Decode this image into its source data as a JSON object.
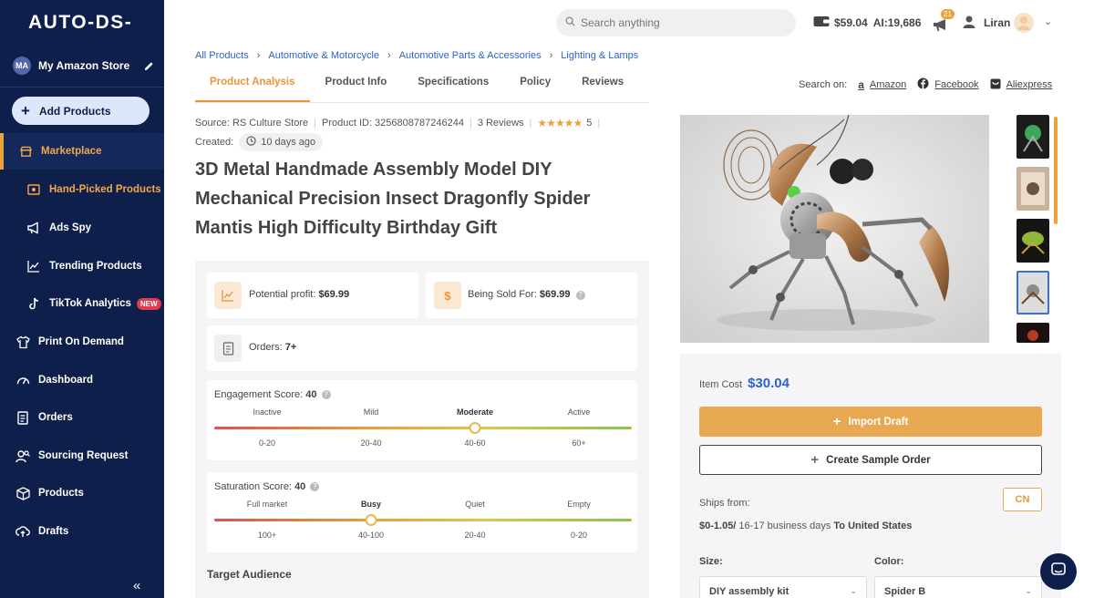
{
  "app": {
    "logo": "AUTO-DS-"
  },
  "sidebar": {
    "store": {
      "initials": "MA",
      "name": "My Amazon Store"
    },
    "add_label": "Add Products",
    "items": [
      {
        "label": "Marketplace",
        "icon": "store-icon"
      },
      {
        "label": "Hand-Picked Products",
        "icon": "hand-picked-icon"
      },
      {
        "label": "Ads Spy",
        "icon": "megaphone-icon"
      },
      {
        "label": "Trending Products",
        "icon": "trending-icon"
      },
      {
        "label": "TikTok Analytics",
        "icon": "tiktok-icon",
        "badge": "NEW"
      },
      {
        "label": "Print On Demand",
        "icon": "shirt-icon"
      },
      {
        "label": "Dashboard",
        "icon": "dashboard-icon"
      },
      {
        "label": "Orders",
        "icon": "orders-icon"
      },
      {
        "label": "Sourcing Request",
        "icon": "sourcing-icon"
      },
      {
        "label": "Products",
        "icon": "box-icon"
      },
      {
        "label": "Drafts",
        "icon": "cloud-upload-icon"
      }
    ],
    "collapse": "«"
  },
  "topbar": {
    "search_placeholder": "Search anything",
    "balance": "$59.04",
    "ai": "AI:19,686",
    "notifications": "21",
    "user": "Liran"
  },
  "breadcrumb": [
    "All Products",
    "Automotive & Motorcycle",
    "Automotive Parts & Accessories",
    "Lighting & Lamps"
  ],
  "tabs": [
    "Product Analysis",
    "Product Info",
    "Specifications",
    "Policy",
    "Reviews"
  ],
  "search_on": {
    "label": "Search on:",
    "links": [
      "Amazon",
      "Facebook",
      "Aliexpress"
    ]
  },
  "product": {
    "source": "Source: RS Culture Store",
    "product_id": "Product ID: 3256808787246244",
    "reviews": "3 Reviews",
    "rating": "5",
    "created_label": "Created:",
    "created_value": "10 days ago",
    "title": "3D Metal Handmade Assembly Model DIY Mechanical Precision Insect Dragonfly Spider Mantis High Difficulty Birthday Gift"
  },
  "analysis": {
    "potential_profit_label": "Potential profit:",
    "potential_profit": "$69.99",
    "sold_for_label": "Being Sold For:",
    "sold_for": "$69.99",
    "orders_label": "Orders:",
    "orders": "7+",
    "engagement": {
      "title": "Engagement Score:",
      "value": "40",
      "labels": [
        "Inactive",
        "Mild",
        "Moderate",
        "Active"
      ],
      "ranges": [
        "0-20",
        "20-40",
        "40-60",
        "60+"
      ],
      "selected": 2,
      "level": 0.625
    },
    "saturation": {
      "title": "Saturation Score:",
      "value": "40",
      "labels": [
        "Full market",
        "Busy",
        "Quiet",
        "Empty"
      ],
      "ranges": [
        "100+",
        "40-100",
        "20-40",
        "0-20"
      ],
      "selected": 1,
      "level": 0.375
    },
    "target_audience": "Target Audience"
  },
  "purchase": {
    "item_cost_label": "Item Cost",
    "item_cost": "$30.04",
    "import_label": "Import Draft",
    "sample_label": "Create Sample Order",
    "ships_from_label": "Ships from:",
    "country": "CN",
    "shipping_price": "$0-1.05/",
    "shipping_days": " 16-17 business days ",
    "shipping_dest": "To United States",
    "size_label": "Size:",
    "size_value": "DIY assembly kit",
    "color_label": "Color:",
    "color_value": "Spider B"
  },
  "colors": {
    "sidebar": "#0f1f4b",
    "accent": "#e8a43a",
    "link": "#2b63c6"
  }
}
